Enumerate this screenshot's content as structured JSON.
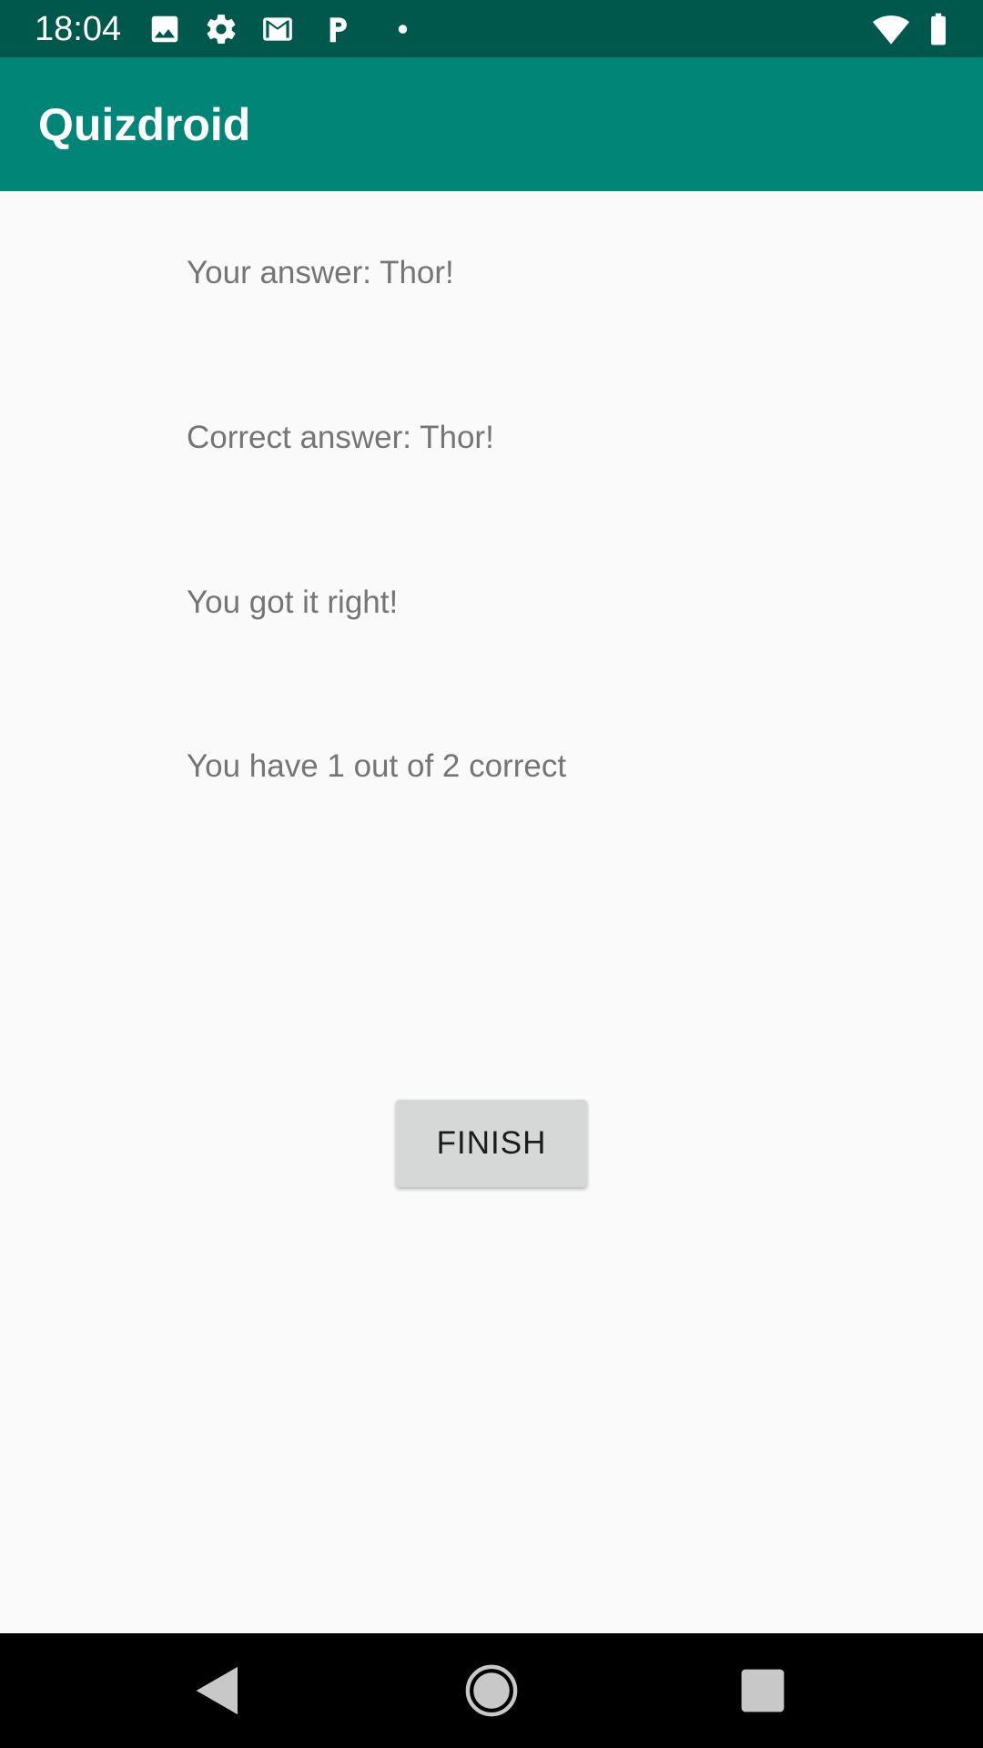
{
  "status_bar": {
    "time": "18:04",
    "left_icons": [
      "image-icon",
      "settings-gear-icon",
      "gmail-icon",
      "parking-p-icon",
      "dot-icon"
    ],
    "right_icons": [
      "wifi-icon",
      "battery-icon"
    ],
    "bg_color": "#00574b"
  },
  "app_bar": {
    "title": "Quizdroid",
    "bg_color": "#008577"
  },
  "result": {
    "your_answer": "Your answer: Thor!",
    "correct_answer": "Correct answer: Thor!",
    "verdict": "You got it right!",
    "score": "You have 1 out of 2 correct"
  },
  "actions": {
    "finish_label": "FINISH"
  },
  "nav_bar": {
    "icons": [
      "back-icon",
      "home-icon",
      "recents-icon"
    ]
  }
}
